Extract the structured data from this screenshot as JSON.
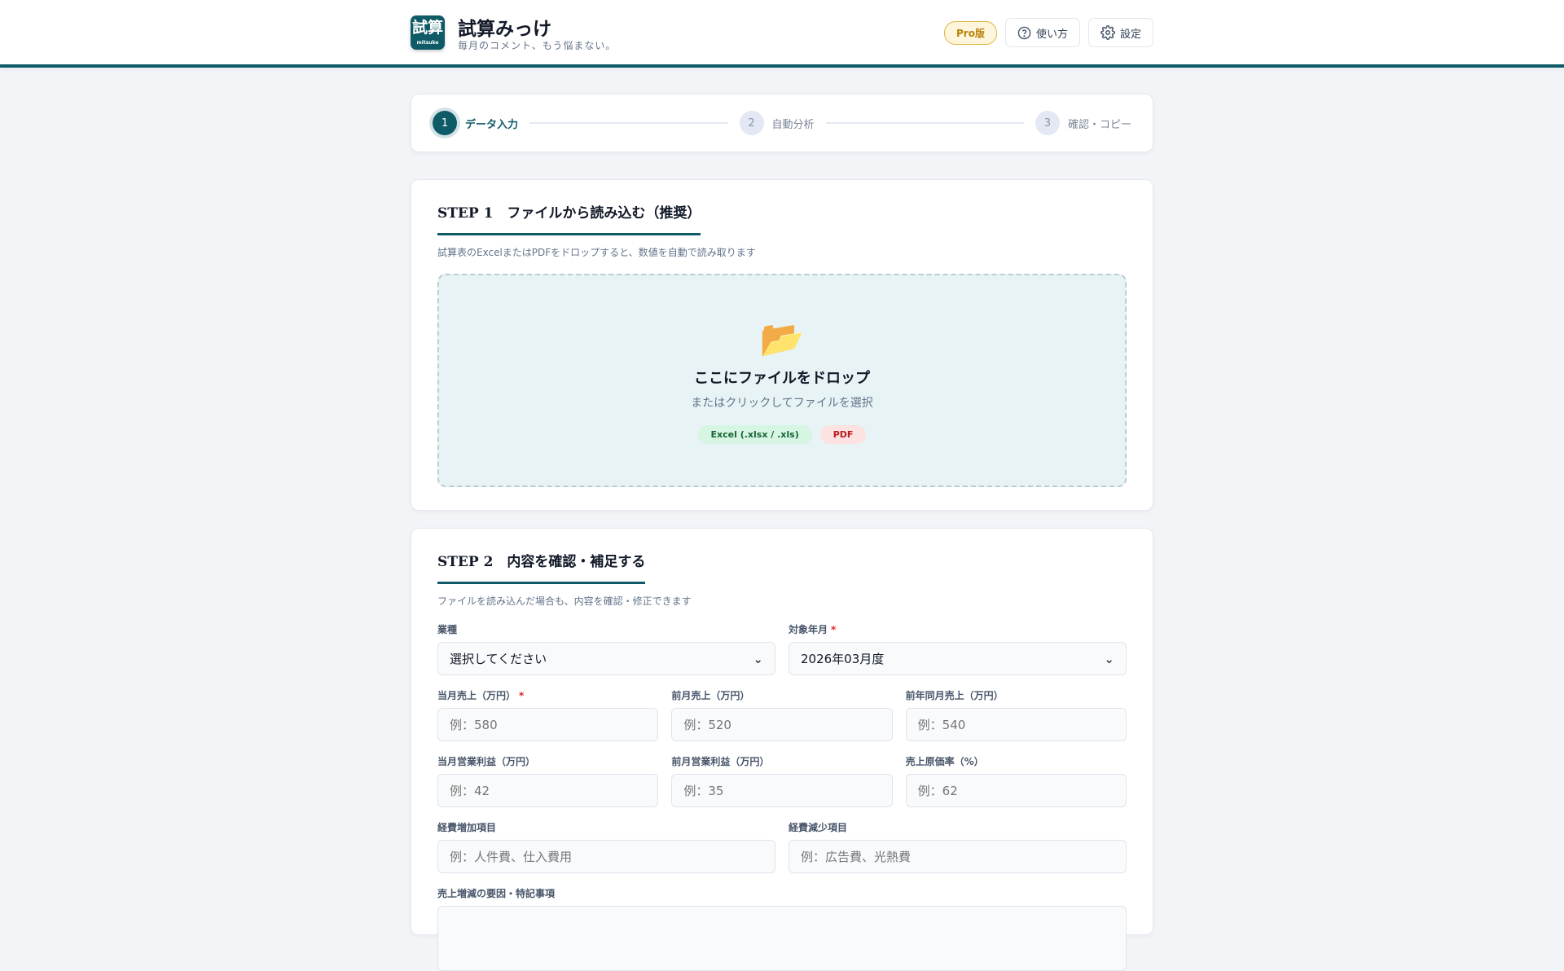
{
  "header": {
    "logo_text": "試算",
    "logo_sub": "mitsuke",
    "title": "試算みっけ",
    "subtitle": "毎月のコメント、もう悩まない。",
    "pro_badge": "Pro版",
    "help_label": "使い方",
    "settings_label": "設定"
  },
  "stepper": [
    {
      "num": "1",
      "label": "データ入力"
    },
    {
      "num": "2",
      "label": "自動分析"
    },
    {
      "num": "3",
      "label": "確認・コピー"
    }
  ],
  "step1": {
    "title": "STEP 1　ファイルから読み込む（推奨）",
    "description": "試算表のExcelまたはPDFをドロップすると、数値を自動で読み取ります",
    "drop_title": "ここにファイルをドロップ",
    "drop_sub": "またはクリックしてファイルを選択",
    "tags": [
      "Excel (.xlsx / .xls)",
      "PDF"
    ]
  },
  "step2": {
    "title": "STEP 2　内容を確認・補足する",
    "description": "ファイルを読み込んだ場合も、内容を確認・修正できます",
    "industry": {
      "label": "業種",
      "value": "選択してください"
    },
    "period": {
      "label": "対象年月",
      "value": "2026年03月度"
    },
    "fields_row1": [
      {
        "label": "当月売上（万円）",
        "placeholder": "例：580"
      },
      {
        "label": "前月売上（万円）",
        "placeholder": "例：520"
      },
      {
        "label": "前年同月売上（万円）",
        "placeholder": "例：540"
      }
    ],
    "fields_row2": [
      {
        "label": "当月営業利益（万円）",
        "placeholder": "例：42"
      },
      {
        "label": "前月営業利益（万円）",
        "placeholder": "例：35"
      },
      {
        "label": "売上原価率（%）",
        "placeholder": "例：62"
      }
    ],
    "expense_up": {
      "label": "経費増加項目",
      "placeholder": "例：人件費、仕入費用"
    },
    "expense_down": {
      "label": "経費減少項目",
      "placeholder": "例：広告費、光熱費"
    },
    "notes_label": "売上増減の要因・特記事項",
    "required_mark": "*"
  }
}
